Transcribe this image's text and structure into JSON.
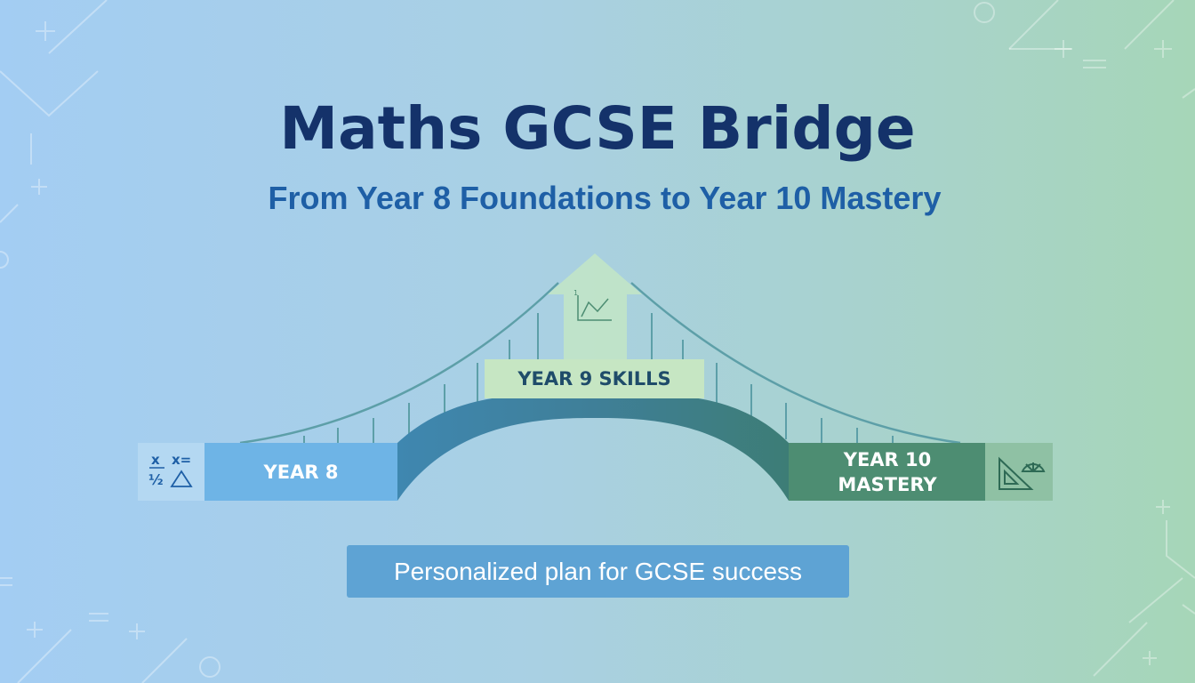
{
  "header": {
    "title": "Maths GCSE Bridge",
    "subtitle": "From Year 8 Foundations to Year 10 Mastery"
  },
  "bridge": {
    "start_label": "YEAR 8",
    "middle_label": "YEAR 9 SKILLS",
    "end_label": "YEAR 10\nMASTERY",
    "start_icon": "math-symbols-icon",
    "middle_icon": "graph-arrow-icon",
    "end_icon": "set-square-protractor-icon",
    "icon_text": {
      "x": "x",
      "eq": "x=",
      "half": "½"
    }
  },
  "footer": {
    "plan_label": "Personalized plan for GCSE success"
  },
  "colors": {
    "title": "#14326a",
    "subtitle": "#1e5fa6",
    "year8": "#6eb4e6",
    "year9": "#c6e6c3",
    "year10": "#4d8d72",
    "bridge_arch_left": "#3f87b0",
    "bridge_arch_right": "#3d7d76",
    "plan_box": "#5ea3d4"
  }
}
